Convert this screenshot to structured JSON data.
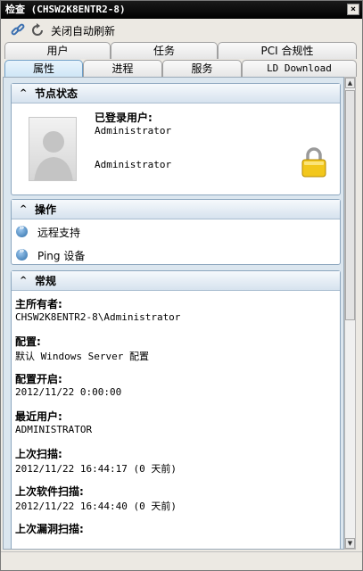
{
  "window": {
    "title": "检查 (CHSW2K8ENTR2-8)",
    "close_glyph": "×"
  },
  "toolbar": {
    "refresh_label": "关闭自动刷新"
  },
  "tabs_row1": [
    "用户",
    "任务",
    "PCI 合规性"
  ],
  "tabs_row2": [
    "属性",
    "进程",
    "服务",
    "LD Download"
  ],
  "active_tab": "属性",
  "node_status": {
    "header": "节点状态",
    "logged_in_label": "已登录用户:",
    "logged_in_value": "Administrator",
    "user_name": "Administrator"
  },
  "operations": {
    "header": "操作",
    "items": [
      "远程支持",
      "Ping 设备"
    ]
  },
  "general": {
    "header": "常规",
    "fields": [
      {
        "label": "主所有者:",
        "value": "CHSW2K8ENTR2-8\\Administrator"
      },
      {
        "label": "配置:",
        "value": "默认 Windows Server 配置"
      },
      {
        "label": "配置开启:",
        "value": "2012/11/22 0:00:00"
      },
      {
        "label": "最近用户:",
        "value": "ADMINISTRATOR"
      },
      {
        "label": "上次扫描:",
        "value": "2012/11/22 16:44:17 (0 天前)"
      },
      {
        "label": "上次软件扫描:",
        "value": "2012/11/22 16:44:40 (0 天前)"
      },
      {
        "label": "上次漏洞扫描:",
        "value": ""
      }
    ]
  },
  "icons": {
    "link": "link-icon",
    "refresh": "refresh-icon",
    "lock": "lock-icon",
    "avatar": "user-avatar-icon",
    "action": "chevron-circle-icon"
  },
  "colors": {
    "accent": "#2d6ea9",
    "titlebar": "#000000",
    "active_tab": "#cfe6f6"
  }
}
